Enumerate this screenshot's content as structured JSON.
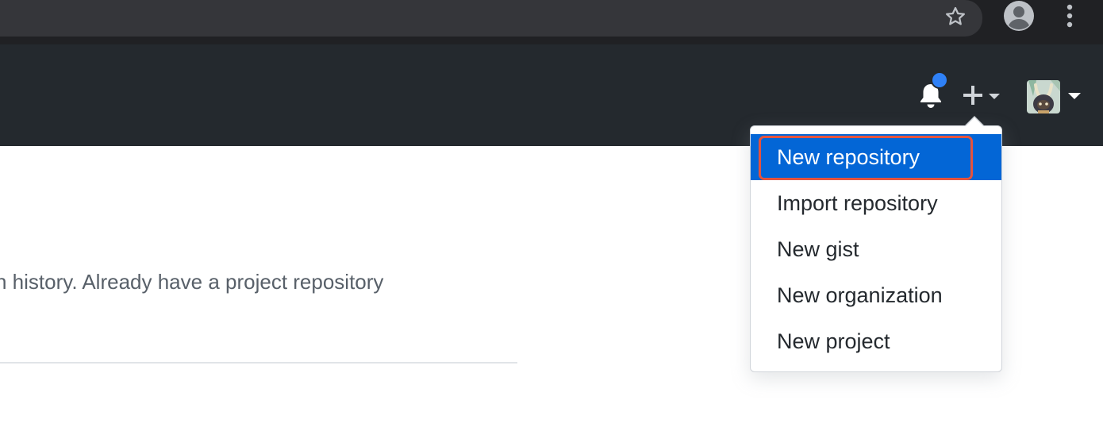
{
  "browser": {
    "star_icon": "star-outline-icon",
    "profile_icon": "account-circle-icon",
    "menu_icon": "more-vert-icon"
  },
  "header": {
    "notifications_icon": "bell-icon",
    "notification_dot_color": "#2f81f7",
    "create_icon": "plus-icon",
    "avatar_alt": "user-avatar"
  },
  "page": {
    "body_text": "n history. Already have a project repository"
  },
  "dropdown": {
    "items": [
      {
        "label": "New repository",
        "active": true
      },
      {
        "label": "Import repository",
        "active": false
      },
      {
        "label": "New gist",
        "active": false
      },
      {
        "label": "New organization",
        "active": false
      },
      {
        "label": "New project",
        "active": false
      }
    ]
  },
  "colors": {
    "browser_bg": "#202124",
    "omnibox_bg": "#35363a",
    "header_bg": "#24292e",
    "active_item": "#0366d6",
    "highlight_outline": "#e5533d"
  }
}
